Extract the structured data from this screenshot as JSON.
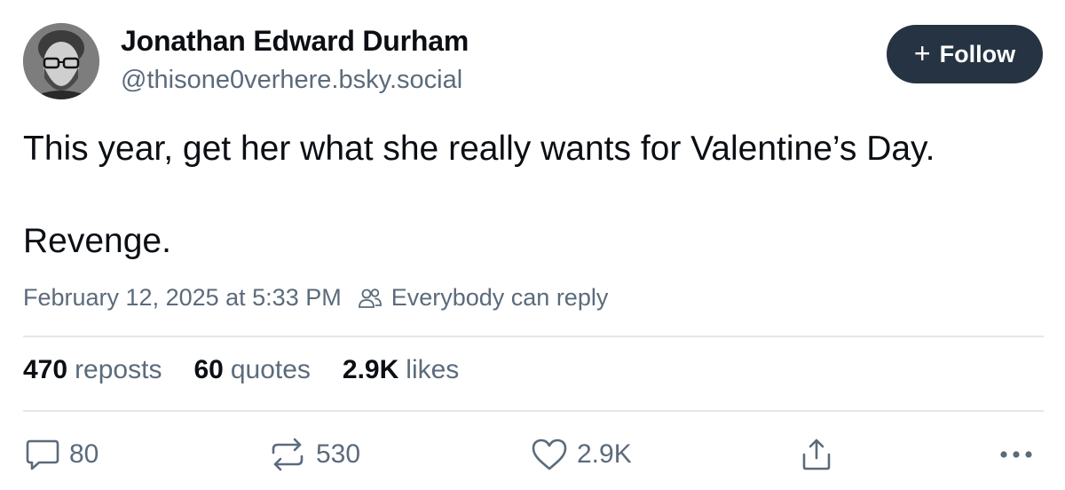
{
  "author": {
    "name": "Jonathan Edward Durham",
    "handle": "@thisone0verhere.bsky.social"
  },
  "follow_button": {
    "plus": "+",
    "label": "Follow"
  },
  "post": {
    "lines": [
      "This year, get her what she really wants for Valentine’s Day.",
      "Revenge."
    ],
    "timestamp": "February 12, 2025 at 5:33 PM",
    "audience": "Everybody can reply"
  },
  "stats": {
    "reposts": {
      "count": "470",
      "label": "reposts"
    },
    "quotes": {
      "count": "60",
      "label": "quotes"
    },
    "likes": {
      "count": "2.9K",
      "label": "likes"
    }
  },
  "actions": {
    "reply": {
      "icon": "reply-bubble-icon",
      "count": "80"
    },
    "repost": {
      "icon": "repost-icon",
      "count": "530"
    },
    "like": {
      "icon": "heart-icon",
      "count": "2.9K"
    },
    "share": {
      "icon": "share-icon"
    },
    "more": {
      "icon": "more-options-icon"
    }
  },
  "colors": {
    "text_primary": "#0b0f14",
    "text_secondary": "#5b6b7b",
    "follow_bg": "#263342",
    "divider": "#e3e8ed"
  }
}
